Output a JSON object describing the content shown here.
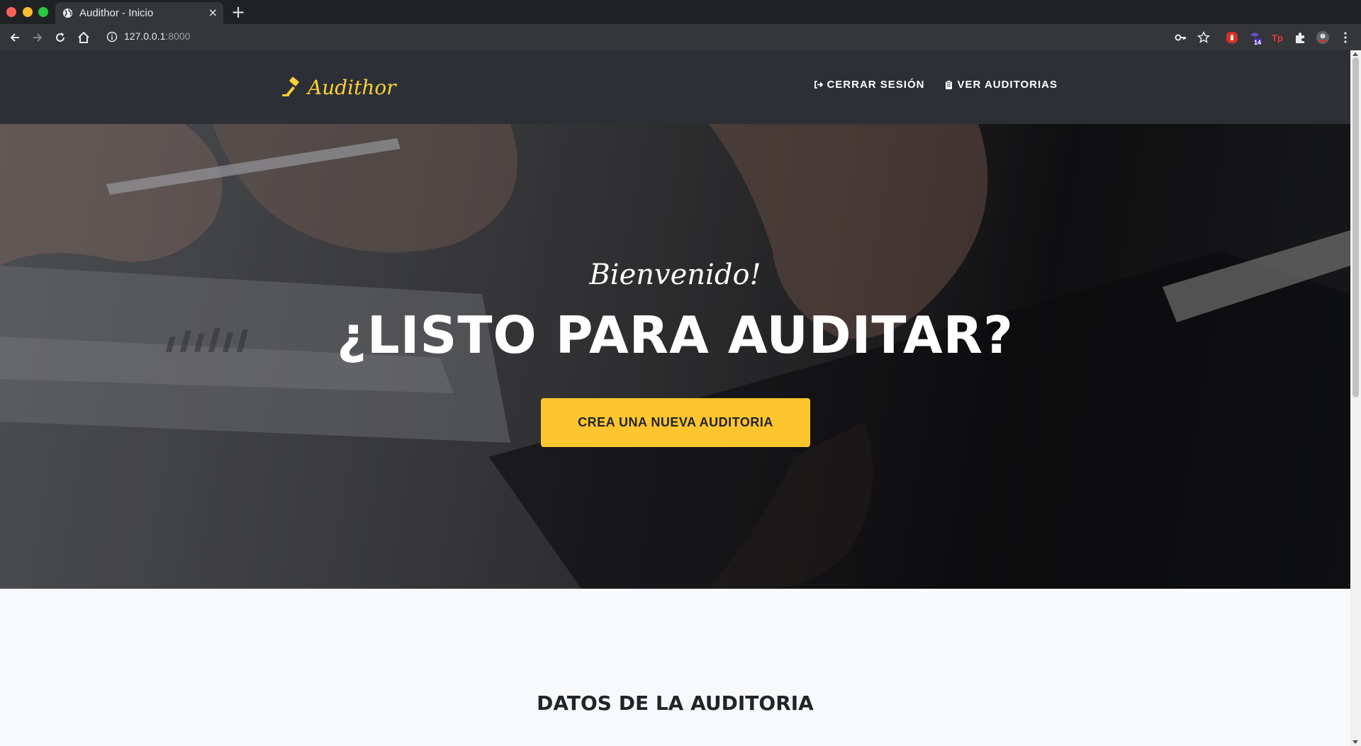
{
  "browser": {
    "tab_title": "Audithor - Inicio",
    "tab_close": "×",
    "new_tab": "+",
    "url_host": "127.0.0.1",
    "url_port": ":8000",
    "extension_badge": "14"
  },
  "navbar": {
    "brand": "Audithor",
    "links": [
      {
        "label": "CERRAR SESIÓN",
        "icon": "sign-out-icon"
      },
      {
        "label": "VER AUDITORIAS",
        "icon": "clipboard-icon"
      }
    ]
  },
  "hero": {
    "subtitle": "Bienvenido!",
    "title": "¿LISTO PARA AUDITAR?",
    "button_label": "CREA UNA NUEVA AUDITORIA"
  },
  "section": {
    "heading": "DATOS DE LA AUDITORIA"
  },
  "colors": {
    "accent": "#fec52e",
    "navbar": "#2c3036"
  }
}
